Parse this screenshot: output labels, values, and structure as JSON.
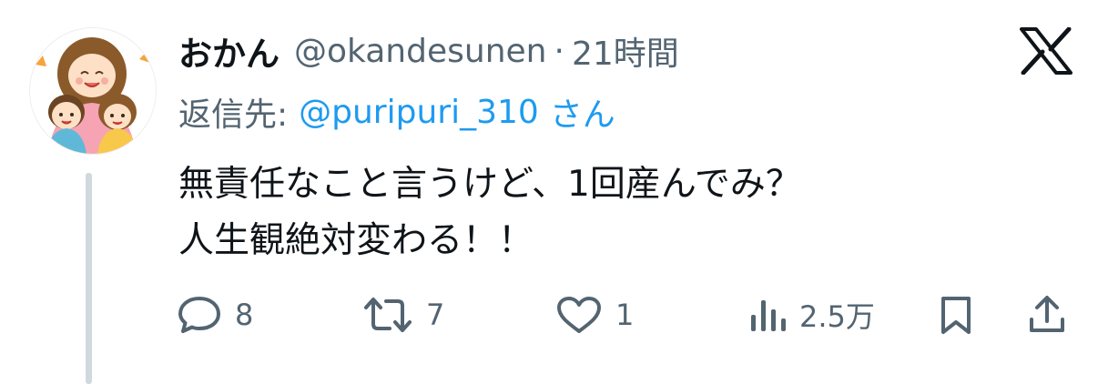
{
  "tweet": {
    "display_name": "おかん",
    "handle": "@okandesunen",
    "separator": "·",
    "timestamp": "21時間",
    "reply": {
      "prefix": "返信先:",
      "handle": "@puripuri_310",
      "suffix": "さん"
    },
    "text_lines": [
      "無責任なこと言うけど、1回産んでみ？",
      "人生観絶対変わる！！"
    ]
  },
  "actions": {
    "reply_count": "8",
    "retweet_count": "7",
    "like_count": "1",
    "views_count": "2.5万"
  },
  "icons": {
    "platform": "x-logo-icon",
    "reply": "speech-bubble-icon",
    "retweet": "retweet-arrows-icon",
    "like": "heart-icon",
    "views": "bar-chart-icon",
    "bookmark": "bookmark-icon",
    "share": "share-upload-icon"
  },
  "colors": {
    "text": "#0f1419",
    "secondary": "#536471",
    "link": "#1d9bf0",
    "thread_line": "#cfd9de"
  }
}
